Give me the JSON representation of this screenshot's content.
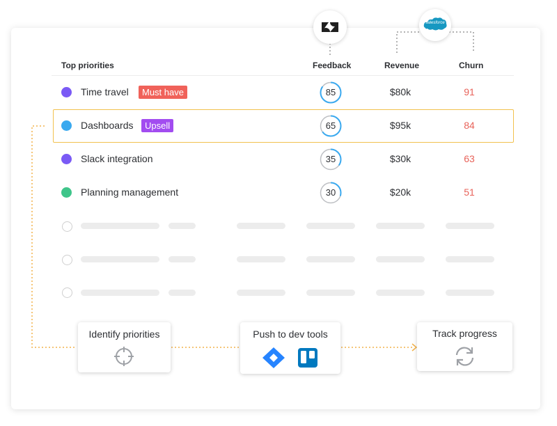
{
  "header": {
    "priorities": "Top priorities",
    "feedback": "Feedback",
    "revenue": "Revenue",
    "churn": "Churn"
  },
  "integrations": {
    "zendesk_icon": "zendesk-logo-icon",
    "salesforce_logo_text": "salesforce"
  },
  "rows": [
    {
      "label": "Time travel",
      "tag": "Must have",
      "tag_color": "#f0625a",
      "dot_color": "#7a5af5",
      "feedback": 85,
      "revenue": "$80k",
      "churn": "91"
    },
    {
      "label": "Dashboards",
      "tag": "Upsell",
      "tag_color": "#a24cf0",
      "dot_color": "#3aa9ef",
      "feedback": 65,
      "revenue": "$95k",
      "churn": "84"
    },
    {
      "label": "Slack integration",
      "tag": "",
      "dot_color": "#7a5af5",
      "feedback": 35,
      "revenue": "$30k",
      "churn": "63"
    },
    {
      "label": "Planning management",
      "tag": "",
      "dot_color": "#3fc58a",
      "feedback": 30,
      "revenue": "$20k",
      "churn": "51"
    }
  ],
  "steps": {
    "identify": {
      "title": "Identify priorities",
      "icon": "crosshair-icon"
    },
    "push": {
      "title": "Push to dev tools",
      "icons": [
        "jira-icon",
        "trello-icon"
      ]
    },
    "track": {
      "title": "Track progress",
      "icon": "sync-icon"
    }
  },
  "colors": {
    "accent_orange": "#f2b24a",
    "gauge_ring": "#3aa9ef",
    "churn_text": "#e8635a",
    "jira_blue": "#2684ff",
    "trello_blue": "#0079bf",
    "salesforce_blue": "#1798c1"
  }
}
